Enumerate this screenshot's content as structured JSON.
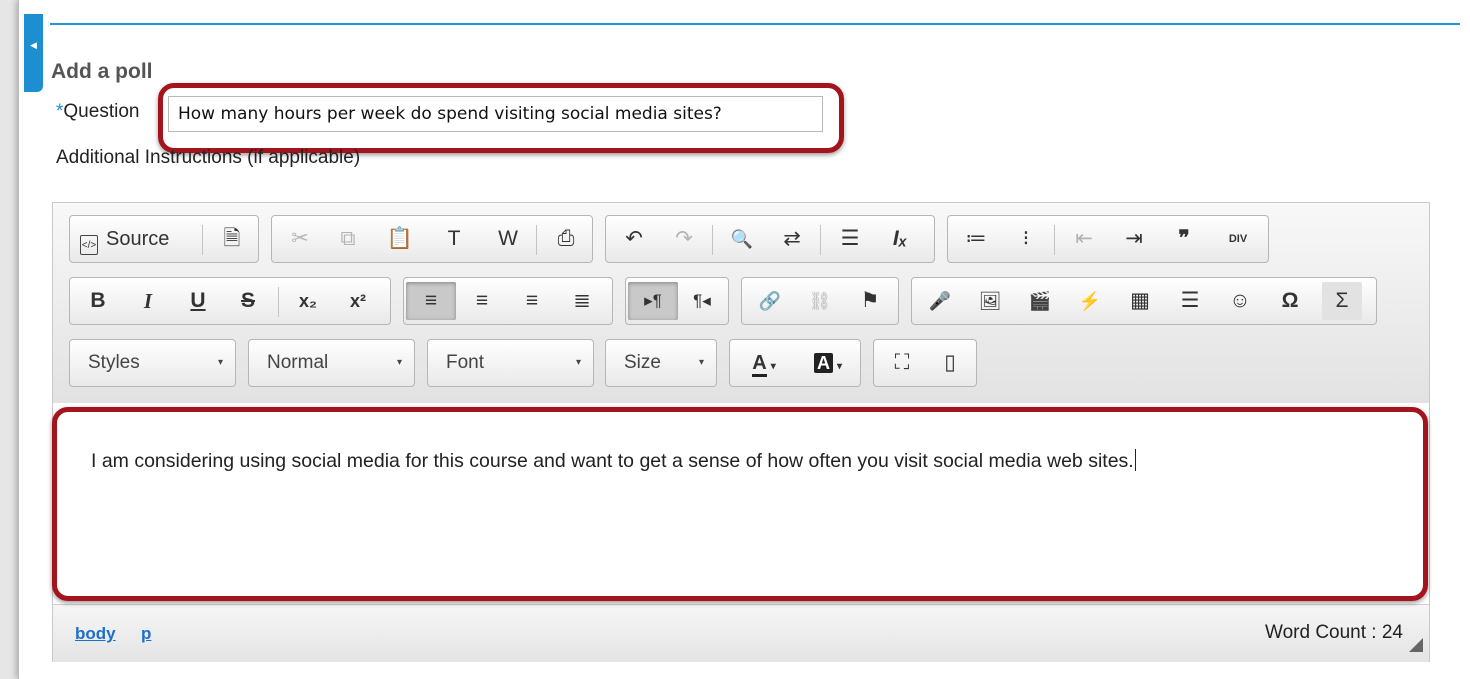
{
  "page": {
    "title": "Add a poll",
    "question_required_marker": "*",
    "question_label": "Question",
    "question_value": "How many hours per week do spend visiting social media sites?",
    "instructions_label": "Additional Instructions (if applicable)"
  },
  "colors": {
    "accent": "#1d8fd0",
    "highlight": "#a4141c",
    "link": "#1d6fc9"
  },
  "toolbar": {
    "row1": {
      "source_label": "Source",
      "source_icon": "view-source-icon",
      "items": [
        {
          "name": "templates-icon",
          "glyph": "🗎"
        },
        {
          "name": "cut-icon",
          "glyph": "✂"
        },
        {
          "name": "copy-icon",
          "glyph": "⧉"
        },
        {
          "name": "paste-icon",
          "glyph": "📋"
        },
        {
          "name": "paste-text-icon",
          "glyph": "T"
        },
        {
          "name": "paste-word-icon",
          "glyph": "W"
        },
        {
          "name": "print-icon",
          "glyph": "⎙"
        },
        {
          "name": "undo-icon",
          "glyph": "↶"
        },
        {
          "name": "redo-icon",
          "glyph": "↷"
        },
        {
          "name": "find-icon",
          "glyph": "🔍"
        },
        {
          "name": "replace-icon",
          "glyph": "⇄"
        },
        {
          "name": "select-all-icon",
          "glyph": "☰"
        },
        {
          "name": "remove-format-icon",
          "glyph": "Iₓ"
        },
        {
          "name": "numbered-list-icon",
          "glyph": "≔"
        },
        {
          "name": "bulleted-list-icon",
          "glyph": "⁝"
        },
        {
          "name": "decrease-indent-icon",
          "glyph": "⇤"
        },
        {
          "name": "increase-indent-icon",
          "glyph": "⇥"
        },
        {
          "name": "blockquote-icon",
          "glyph": "❞"
        },
        {
          "name": "div-container-icon",
          "glyph": "DIV"
        }
      ]
    },
    "row2": {
      "items": [
        {
          "name": "bold-icon",
          "glyph": "B"
        },
        {
          "name": "italic-icon",
          "glyph": "I"
        },
        {
          "name": "underline-icon",
          "glyph": "U"
        },
        {
          "name": "strikethrough-icon",
          "glyph": "S"
        },
        {
          "name": "subscript-icon",
          "glyph": "x₂"
        },
        {
          "name": "superscript-icon",
          "glyph": "x²"
        },
        {
          "name": "align-left-icon",
          "glyph": "≡"
        },
        {
          "name": "align-center-icon",
          "glyph": "≡"
        },
        {
          "name": "align-right-icon",
          "glyph": "≡"
        },
        {
          "name": "justify-icon",
          "glyph": "≣"
        },
        {
          "name": "text-direction-ltr-icon",
          "glyph": "▸¶"
        },
        {
          "name": "text-direction-rtl-icon",
          "glyph": "¶◂"
        },
        {
          "name": "link-icon",
          "glyph": "🔗"
        },
        {
          "name": "unlink-icon",
          "glyph": "⛓"
        },
        {
          "name": "anchor-icon",
          "glyph": "⚑"
        },
        {
          "name": "audio-recorder-icon",
          "glyph": "🎤"
        },
        {
          "name": "image-icon",
          "glyph": "🖼"
        },
        {
          "name": "movie-icon",
          "glyph": "🎬"
        },
        {
          "name": "flash-icon",
          "glyph": "⚡"
        },
        {
          "name": "table-icon",
          "glyph": "▦"
        },
        {
          "name": "horizontal-line-icon",
          "glyph": "☰"
        },
        {
          "name": "smiley-icon",
          "glyph": "☺"
        },
        {
          "name": "special-char-icon",
          "glyph": "Ω"
        },
        {
          "name": "math-icon",
          "glyph": "Σ"
        }
      ]
    },
    "row3": {
      "styles": "Styles",
      "format": "Normal",
      "font": "Font",
      "size": "Size",
      "text_color_glyph": "A",
      "bg_color_glyph": "A",
      "caret": "▾",
      "maximize_icon": "maximize-icon",
      "show_blocks_icon": "show-blocks-icon"
    }
  },
  "editor": {
    "body_text": "I am considering using social media for this course and want to get a sense of how often you visit social media web sites."
  },
  "status": {
    "path": [
      "body",
      "p"
    ],
    "word_count": "Word Count : 24"
  }
}
